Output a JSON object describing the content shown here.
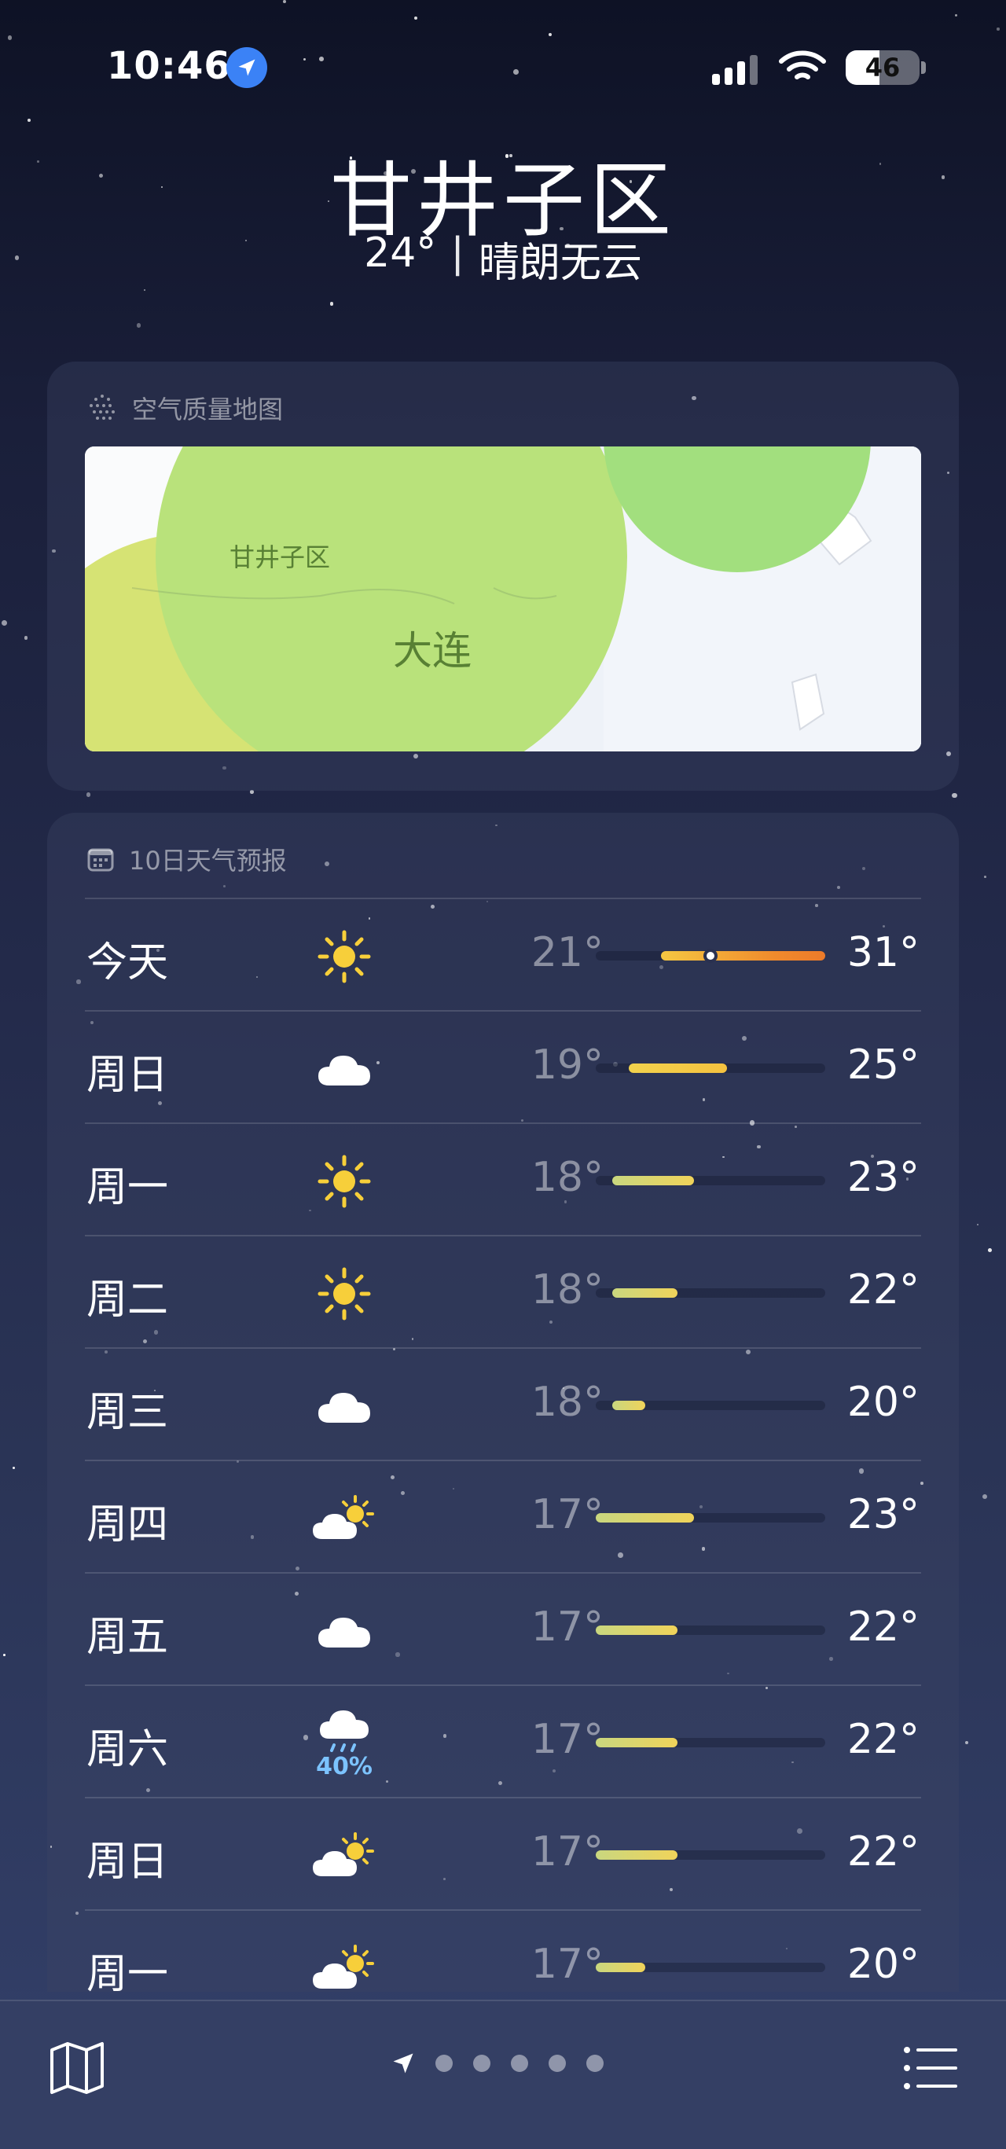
{
  "status_bar": {
    "time": "10:46",
    "battery": "46",
    "battery_level_percent": 46
  },
  "header": {
    "city": "甘井子区",
    "temperature": "24°",
    "separator": "|",
    "condition": "晴朗无云"
  },
  "air_quality": {
    "title": "空气质量地图",
    "map_labels": {
      "district": "甘井子区",
      "city": "大连"
    }
  },
  "forecast": {
    "title": "10日天气预报",
    "days": [
      {
        "day": "今天",
        "icon": "sun-icon",
        "low": "21°",
        "high": "31°",
        "range": [
          21,
          31
        ],
        "current": 24,
        "precip": ""
      },
      {
        "day": "周日",
        "icon": "cloud-icon",
        "low": "19°",
        "high": "25°",
        "range": [
          19,
          25
        ],
        "precip": ""
      },
      {
        "day": "周一",
        "icon": "sun-icon",
        "low": "18°",
        "high": "23°",
        "range": [
          18,
          23
        ],
        "precip": ""
      },
      {
        "day": "周二",
        "icon": "sun-icon",
        "low": "18°",
        "high": "22°",
        "range": [
          18,
          22
        ],
        "precip": ""
      },
      {
        "day": "周三",
        "icon": "cloud-icon",
        "low": "18°",
        "high": "20°",
        "range": [
          18,
          20
        ],
        "precip": ""
      },
      {
        "day": "周四",
        "icon": "partly-sunny-icon",
        "low": "17°",
        "high": "23°",
        "range": [
          17,
          23
        ],
        "precip": ""
      },
      {
        "day": "周五",
        "icon": "cloud-icon",
        "low": "17°",
        "high": "22°",
        "range": [
          17,
          22
        ],
        "precip": ""
      },
      {
        "day": "周六",
        "icon": "rain-icon",
        "low": "17°",
        "high": "22°",
        "range": [
          17,
          22
        ],
        "precip": "40%"
      },
      {
        "day": "周日",
        "icon": "partly-sunny-icon",
        "low": "17°",
        "high": "22°",
        "range": [
          17,
          22
        ],
        "precip": ""
      },
      {
        "day": "周一",
        "icon": "partly-sunny-icon",
        "low": "17°",
        "high": "20°",
        "range": [
          17,
          20
        ],
        "precip": ""
      }
    ]
  },
  "toolbar": {
    "page_count": 5,
    "icons": [
      "map-icon",
      "location-arrow-icon",
      "list-icon"
    ]
  }
}
